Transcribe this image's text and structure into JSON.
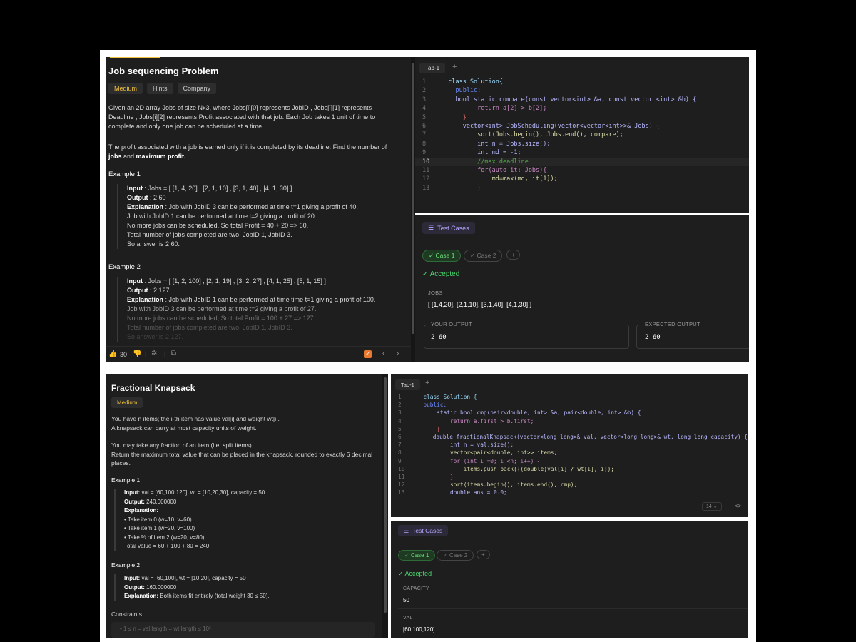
{
  "screenshot1": {
    "problem": {
      "title": "Job sequencing Problem",
      "tags": [
        "Medium",
        "Hints",
        "Company"
      ],
      "para1": "Given an 2D array Jobs of size Nx3, where Jobs[i][0] represents JobID , Jobs[i][1] represents Deadline , Jobs[i][2] represents Profit associated with that job. Each Job takes 1 unit of time to complete and only one job can be scheduled at a time.",
      "para2_a": "The profit associated with a job is earned only if it is completed by its deadline. Find the number of ",
      "para2_b": "jobs",
      "para2_c": " and ",
      "para2_d": "maximum profit.",
      "example1": {
        "title": "Example 1",
        "input_label": "Input",
        "input": " : Jobs = [ [1, 4, 20] , [2, 1, 10] , [3, 1, 40] , [4, 1, 30] ]",
        "output_label": "Output",
        "output": " : 2 60",
        "explanation_label": "Explanation",
        "lines": [
          " : Job with JobID 3 can be performed at time t=1 giving a profit of 40.",
          "Job with JobID 1 can be performed at time t=2 giving a profit of 20.",
          "No more jobs can be scheduled, So total Profit = 40 + 20 => 60.",
          "Total number of jobs completed are two, JobID 1, JobID 3.",
          "So answer is 2 60."
        ]
      },
      "example2": {
        "title": "Example 2",
        "input_label": "Input",
        "input": " : Jobs = [ [1, 2, 100] , [2, 1, 19] , [3, 2, 27] , [4, 1, 25] , [5, 1, 15] ]",
        "output_label": "Output",
        "output": " : 2 127",
        "explanation_label": "Explanation",
        "lines": [
          " : Job with JobID 1 can be performed at time time t=1 giving a profit of 100.",
          "Job with JobID 3 can be performed at time t=2 giving a profit of 27.",
          "No more jobs can be scheduled, So total Profit = 100 + 27 => 127.",
          "Total number of jobs completed are two, JobID 1, JobID 3.",
          "So answer is 2 127."
        ]
      }
    },
    "footer": {
      "likes": "30"
    },
    "editor": {
      "tab": "Tab-1",
      "plus": "+",
      "lines": [
        {
          "n": "1",
          "t": "  class Solution{"
        },
        {
          "n": "2",
          "t": "    public:"
        },
        {
          "n": "3",
          "t": "    bool static compare(const vector<int> &a, const vector <int> &b) {"
        },
        {
          "n": "4",
          "t": "          return a[2] > b[2];"
        },
        {
          "n": "5",
          "t": "      }"
        },
        {
          "n": "6",
          "t": "      vector<int> JobScheduling(vector<vector<int>>& Jobs) {"
        },
        {
          "n": "7",
          "t": "          sort(Jobs.begin(), Jobs.end(), compare);"
        },
        {
          "n": "8",
          "t": "          int n = Jobs.size();"
        },
        {
          "n": "9",
          "t": "          int md = -1;"
        },
        {
          "n": "10",
          "t": "          //max deadline"
        },
        {
          "n": "11",
          "t": "          for(auto it: Jobs){"
        },
        {
          "n": "12",
          "t": "              md=max(md, it[1]);"
        },
        {
          "n": "13",
          "t": "          }"
        }
      ]
    },
    "tests": {
      "badge": "Test Cases",
      "case1": "Case 1",
      "case2": "Case 2",
      "add": "+",
      "status": "Accepted",
      "input_label": "JOBS",
      "input_value": "[ [1,4,20], [2,1,10], [3,1,40], [4,1,30] ]",
      "your_output_label": "YOUR OUTPUT",
      "your_output": "2 60",
      "expected_label": "EXPECTED OUTPUT",
      "expected": "2 60"
    }
  },
  "screenshot2": {
    "problem": {
      "title": "Fractional Knapsack",
      "tag": "Medium",
      "p1": "You have n items; the i-th item has value val[i] and weight wt[i].",
      "p2": "A knapsack can carry at most capacity units of weight.",
      "p3": "You may take any fraction of an item (i.e. split items).",
      "p4": "Return the maximum total value that can be placed in the knapsack, rounded to exactly 6 decimal places.",
      "example1": {
        "title": "Example 1",
        "input_label": "Input:",
        "input": " val = [60,100,120], wt = [10,20,30], capacity = 50",
        "output_label": "Output:",
        "output": " 240.000000",
        "explanation_label": "Explanation:",
        "bullets": [
          "Take item 0 (w=10, v=60)",
          "Take item 1 (w=20, v=100)",
          "Take ⅔ of item 2 (w=20, v=80)"
        ],
        "total": "Total value = 60 + 100 + 80 = 240"
      },
      "example2": {
        "title": "Example 2",
        "input_label": "Input:",
        "input": " val = [60,100], wt = [10,20], capacity = 50",
        "output_label": "Output:",
        "output": " 160.000000",
        "explanation_label": "Explanation:",
        "explanation": " Both items fit entirely (total weight 30 ≤ 50)."
      },
      "constraints_title": "Constraints",
      "constraint1": "1 ≤ n = val.length = wt.length ≤ 10⁵"
    },
    "editor": {
      "tab": "Tab-1",
      "plus": "+",
      "lines": [
        {
          "n": "1",
          "t": "  class Solution {"
        },
        {
          "n": "2",
          "t": "  public:"
        },
        {
          "n": "3",
          "t": "      static bool cmp(pair<double, int> &a, pair<double, int> &b) {"
        },
        {
          "n": "4",
          "t": "          return a.first > b.first;"
        },
        {
          "n": "5",
          "t": "      }"
        },
        {
          "n": "6",
          "t": "      double fractionalKnapsack(vector<long long>& val, vector<long long>& wt, long long capacity) {"
        },
        {
          "n": "7",
          "t": "          int n = val.size();"
        },
        {
          "n": "8",
          "t": "          vector<pair<double, int>> items;"
        },
        {
          "n": "9",
          "t": "          for (int i =0; i <n; i++) {"
        },
        {
          "n": "10",
          "t": "              items.push_back({(double)val[i] / wt[i], i});"
        },
        {
          "n": "11",
          "t": "          }"
        },
        {
          "n": "12",
          "t": "          sort(items.begin(), items.end(), cmp);"
        },
        {
          "n": "13",
          "t": "          double ans = 0.0;"
        }
      ],
      "font_size": "14",
      "nav": "<>"
    },
    "tests": {
      "badge": "Test Cases",
      "case1": "Case 1",
      "case2": "Case 2",
      "add": "+",
      "status": "Accepted",
      "capacity_label": "CAPACITY",
      "capacity_value": "50",
      "val_label": "VAL",
      "val_value": "[60,100,120]"
    }
  }
}
